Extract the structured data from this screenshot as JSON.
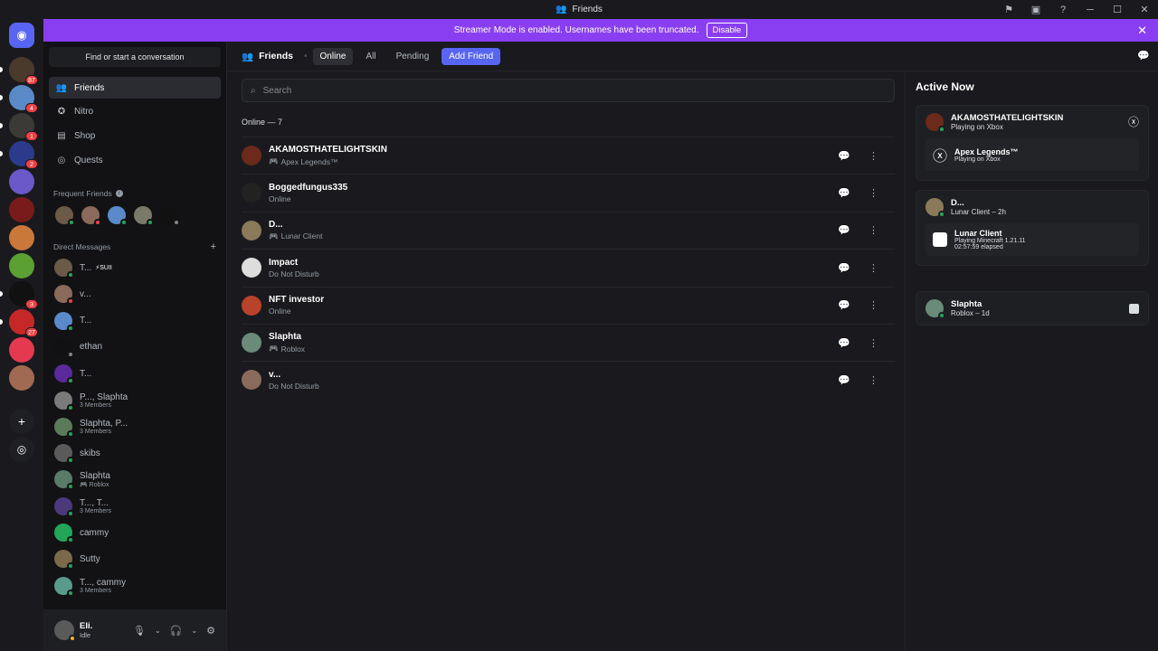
{
  "window": {
    "title": "Friends"
  },
  "banner": {
    "text": "Streamer Mode is enabled. Usernames have been truncated.",
    "button": "Disable"
  },
  "guilds": [
    {
      "badge": "",
      "color": "#5865f2"
    },
    {
      "badge": "87",
      "color": "#4a3a2c"
    },
    {
      "badge": "4",
      "color": "#5b8ac9"
    },
    {
      "badge": "1",
      "color": "#3c3a36"
    },
    {
      "badge": "2",
      "color": "#2b3a8a"
    },
    {
      "badge": "",
      "color": "#6b58c9"
    },
    {
      "badge": "",
      "color": "#7a1b1b"
    },
    {
      "badge": "",
      "color": "#c9783a"
    },
    {
      "badge": "",
      "color": "#5aa033"
    },
    {
      "badge": "3",
      "color": "#111111"
    },
    {
      "badge": "27",
      "color": "#c62828"
    },
    {
      "badge": "",
      "color": "#e53950"
    },
    {
      "badge": "",
      "color": "#a06a52"
    }
  ],
  "sidebar": {
    "find": "Find or start a conversation",
    "nav": [
      {
        "label": "Friends"
      },
      {
        "label": "Nitro"
      },
      {
        "label": "Shop"
      },
      {
        "label": "Quests"
      }
    ],
    "frequent_label": "Frequent Friends",
    "dm_label": "Direct Messages",
    "dms": [
      {
        "name": "T...",
        "tag": "⚡SUII",
        "sub": "",
        "status": "online",
        "color": "#6b5a48"
      },
      {
        "name": "v...",
        "tag": "",
        "sub": "",
        "status": "dnd",
        "color": "#8a6a5a"
      },
      {
        "name": "T...",
        "tag": "",
        "sub": "",
        "status": "online",
        "color": "#5a8ac9"
      },
      {
        "name": "ethan",
        "tag": "",
        "sub": "",
        "status": "off",
        "color": "#111111"
      },
      {
        "name": "T...",
        "tag": "",
        "sub": "",
        "status": "online",
        "color": "#5a2a9a"
      },
      {
        "name": "P..., Slaphta",
        "tag": "",
        "sub": "3 Members",
        "status": "online",
        "color": "#7a7a7a"
      },
      {
        "name": "Slaphta, P...",
        "tag": "",
        "sub": "3 Members",
        "status": "online",
        "color": "#5a7a5a"
      },
      {
        "name": "skibs",
        "tag": "",
        "sub": "",
        "status": "online",
        "color": "#5a5a5a"
      },
      {
        "name": "Slaphta",
        "tag": "",
        "sub": "🎮 Roblox",
        "status": "online",
        "color": "#5a7a6a"
      },
      {
        "name": "T..., T...",
        "tag": "",
        "sub": "3 Members",
        "status": "online",
        "color": "#4a3a7a"
      },
      {
        "name": "cammy",
        "tag": "",
        "sub": "",
        "status": "online",
        "color": "#23a55a"
      },
      {
        "name": "Sutty",
        "tag": "",
        "sub": "",
        "status": "online",
        "color": "#7a6a4a"
      },
      {
        "name": "T..., cammy",
        "tag": "",
        "sub": "3 Members",
        "status": "online",
        "color": "#5a9a8a"
      }
    ],
    "user": {
      "name": "Eli.",
      "status": "Idle"
    }
  },
  "main": {
    "title": "Friends",
    "tabs": [
      "Online",
      "All",
      "Pending",
      "Add Friend"
    ],
    "search_placeholder": "Search",
    "online_label": "Online — 7",
    "friends": [
      {
        "name": "AKAMOSTHATELIGHTSKIN",
        "sub": "Apex Legends™",
        "game": true,
        "status": "online",
        "color": "#6b2a1a"
      },
      {
        "name": "Boggedfungus335",
        "sub": "Online",
        "game": false,
        "status": "online",
        "color": "#222222"
      },
      {
        "name": "D...",
        "sub": "Lunar Client",
        "game": true,
        "status": "online",
        "color": "#8a7a5a"
      },
      {
        "name": "Impact",
        "sub": "Do Not Disturb",
        "game": false,
        "status": "dnd",
        "color": "#dddddd"
      },
      {
        "name": "NFT investor",
        "sub": "Online",
        "game": false,
        "status": "online",
        "color": "#b8422a"
      },
      {
        "name": "Slaphta",
        "sub": "Roblox",
        "game": true,
        "status": "online",
        "color": "#6a8a7a"
      },
      {
        "name": "v...",
        "sub": "Do Not Disturb",
        "game": false,
        "status": "dnd",
        "color": "#8a6a5a"
      }
    ]
  },
  "active_now": {
    "title": "Active Now",
    "cards": [
      {
        "name": "AKAMOSTHATELIGHTSKIN",
        "status": "Playing on Xbox",
        "game": "Apex Legends™",
        "detail1": "Playing on Xbox",
        "detail2": ""
      },
      {
        "name": "D...",
        "status": "Lunar Client – 2h",
        "game": "Lunar Client",
        "detail1": "Playing Minecraft 1.21.11",
        "detail2": "02:57:59 elapsed"
      },
      {
        "name": "Slaphta",
        "status": "Roblox – 1d"
      }
    ]
  }
}
